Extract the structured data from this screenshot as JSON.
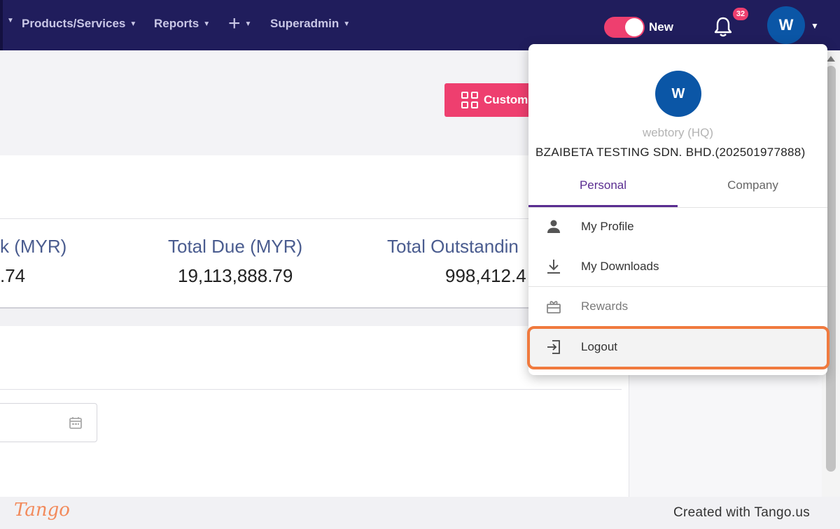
{
  "nav": {
    "items": [
      {
        "label": "Products/Services"
      },
      {
        "label": "Reports"
      },
      {
        "label": "+"
      },
      {
        "label": "Superadmin"
      }
    ],
    "toggle_label": "New",
    "toggle_on": true,
    "notification_count": "32",
    "avatar_initial": "W"
  },
  "toolbar": {
    "custom_button_label": "Custom"
  },
  "summary": {
    "stats": [
      {
        "title": "k (MYR)",
        "value": ".74"
      },
      {
        "title": "Total Due (MYR)",
        "value": "19,113,888.79"
      },
      {
        "title": "Total Outstandin",
        "value": "998,412.4"
      }
    ]
  },
  "dropdown": {
    "avatar_initial": "W",
    "username": "webtory (HQ)",
    "company": "BZAIBETA TESTING SDN. BHD.(202501977888)",
    "tabs": [
      {
        "label": "Personal",
        "active": true
      },
      {
        "label": "Company",
        "active": false
      }
    ],
    "menu": [
      {
        "label": "My Profile",
        "icon": "person-icon"
      },
      {
        "label": "My Downloads",
        "icon": "download-icon"
      },
      {
        "label": "Rewards",
        "icon": "gift-icon"
      },
      {
        "label": "Logout",
        "icon": "logout-icon",
        "highlighted": true
      }
    ]
  },
  "footer": {
    "logo_text": "Tango",
    "credit": "Created with Tango.us"
  },
  "colors": {
    "nav_bg": "#201d5c",
    "accent_pink": "#ee3f6f",
    "avatar_blue": "#0b56a6",
    "tab_active": "#5a2d91",
    "highlight_orange": "#f07a3e"
  }
}
